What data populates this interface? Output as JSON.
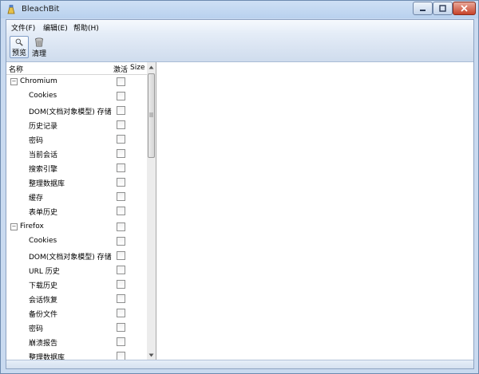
{
  "window": {
    "title": "BleachBit"
  },
  "menu": [
    {
      "label": "文件(F)"
    },
    {
      "label": "编辑(E)"
    },
    {
      "label": "帮助(H)"
    }
  ],
  "toolbar": {
    "preview_label": "预览",
    "clean_label": "清理"
  },
  "tree": {
    "headers": {
      "name": "名称",
      "active": "激活",
      "size": "Size"
    },
    "groups": [
      {
        "name": "Chromium",
        "expander": "−",
        "items": [
          "Cookies",
          "DOM(文档对象模型) 存储",
          "历史记录",
          "密码",
          "当前会话",
          "搜索引擎",
          "整理数据库",
          "缓存",
          "表单历史"
        ]
      },
      {
        "name": "Firefox",
        "expander": "−",
        "items": [
          "Cookies",
          "DOM(文档对象模型) 存储",
          "URL 历史",
          "下载历史",
          "会话恢复",
          "备份文件",
          "密码",
          "崩溃报告",
          "整理数据库"
        ]
      }
    ]
  },
  "icons": {
    "app": "bleachbit-icon",
    "preview": "magnifier-icon",
    "clean": "trash-can-icon"
  },
  "colors": {
    "titlebar": "#c9daf0",
    "close_button": "#c7432a",
    "toolbar": "#dbe6f3"
  }
}
